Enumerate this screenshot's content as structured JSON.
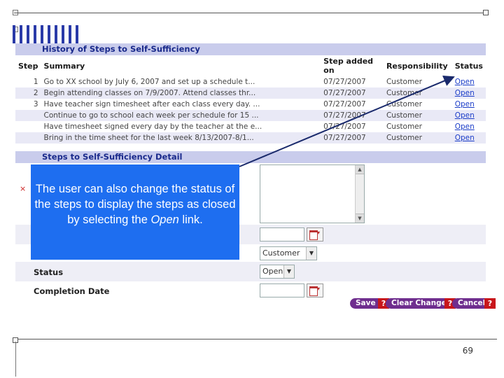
{
  "history": {
    "title": "History of Steps to Self-Sufficiency",
    "columns": [
      "Step",
      "Summary",
      "Step added on",
      "Responsibility",
      "Status"
    ],
    "rows": [
      {
        "step": "1",
        "summary": "Go to XX school by July 6, 2007 and set up a schedule t...",
        "date": "07/27/2007",
        "responsibility": "Customer",
        "status": "Open"
      },
      {
        "step": "2",
        "summary": "Begin attending classes on 7/9/2007. Attend classes thr...",
        "date": "07/27/2007",
        "responsibility": "Customer",
        "status": "Open"
      },
      {
        "step": "3",
        "summary": "Have teacher sign timesheet after each class every day. ...",
        "date": "07/27/2007",
        "responsibility": "Customer",
        "status": "Open"
      },
      {
        "step": "",
        "summary": "Continue to go to school each week per schedule for 15 ...",
        "date": "07/27/2007",
        "responsibility": "Customer",
        "status": "Open"
      },
      {
        "step": "",
        "summary": "Have timesheet signed every day by the teacher at the e...",
        "date": "07/27/2007",
        "responsibility": "Customer",
        "status": "Open"
      },
      {
        "step": "",
        "summary": "Bring in the time sheet for the last week 8/13/2007-8/1...",
        "date": "07/27/2007",
        "responsibility": "Customer",
        "status": "Open"
      }
    ]
  },
  "detail": {
    "title": "Steps to Self-Sufficiency Detail",
    "close_icon": "×",
    "responsibility_value": "Customer",
    "status_label": "Status",
    "status_value": "Open",
    "completion_label": "Completion Date"
  },
  "buttons": {
    "save": "Save",
    "clear": "Clear Changes",
    "cancel": "Cancel",
    "help": "?"
  },
  "callout": {
    "text_before": "The user can also change the status of the steps to display the steps as closed by selecting the ",
    "text_italic": "Open",
    "text_after": " link."
  },
  "slide": {
    "page_number": "69"
  },
  "colors": {
    "callout_bg": "#1e6ef0",
    "section_bg": "#c9ccec",
    "button_purple": "#6f2e8e",
    "help_red": "#c8161b",
    "link": "#1a3cc8"
  }
}
